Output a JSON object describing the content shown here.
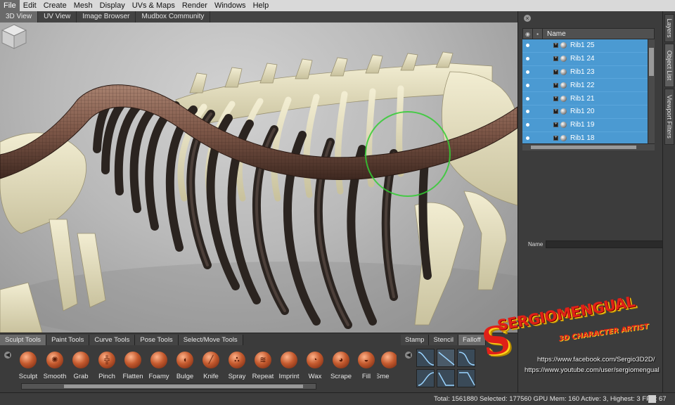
{
  "menu": [
    "File",
    "Edit",
    "Create",
    "Mesh",
    "Display",
    "UVs & Maps",
    "Render",
    "Windows",
    "Help"
  ],
  "viewport_tabs": [
    "3D View",
    "UV View",
    "Image Browser",
    "Mudbox Community"
  ],
  "side_tabs": [
    "Layers",
    "Object List",
    "Viewport Filters"
  ],
  "object_list": {
    "column_name": "Name",
    "items": [
      "Rib1 25",
      "Rib1 24",
      "Rib1 23",
      "Rib1 22",
      "Rib1 21",
      "Rib1 20",
      "Rib1 19",
      "Rib1 18"
    ],
    "name_label": "Name"
  },
  "tray_tabs": [
    "Sculpt Tools",
    "Paint Tools",
    "Curve Tools",
    "Pose Tools",
    "Select/Move Tools"
  ],
  "tools": [
    "Sculpt",
    "Smooth",
    "Grab",
    "Pinch",
    "Flatten",
    "Foamy",
    "Bulge",
    "Knife",
    "Spray",
    "Repeat",
    "Imprint",
    "Wax",
    "Scrape",
    "Fill",
    "Sme"
  ],
  "stamp_tabs": [
    "Stamp",
    "Stencil",
    "Falloff"
  ],
  "status": "Total: 1561880   Selected: 177560 GPU Mem: 160   Active: 3, Highest: 3   FPS: 67",
  "watermark": {
    "title": "SERGIOMENGUAL",
    "subtitle": "3D CHARACTER ARTIST",
    "facebook": "https://www.facebook.com/Sergio3D2D/",
    "youtube": "https://www.youtube.com/user/sergiomengual"
  },
  "colors": {
    "selection_blue": "#4b9ad2",
    "brush_ring": "#33cc33",
    "bone": "#e9e3c4"
  }
}
